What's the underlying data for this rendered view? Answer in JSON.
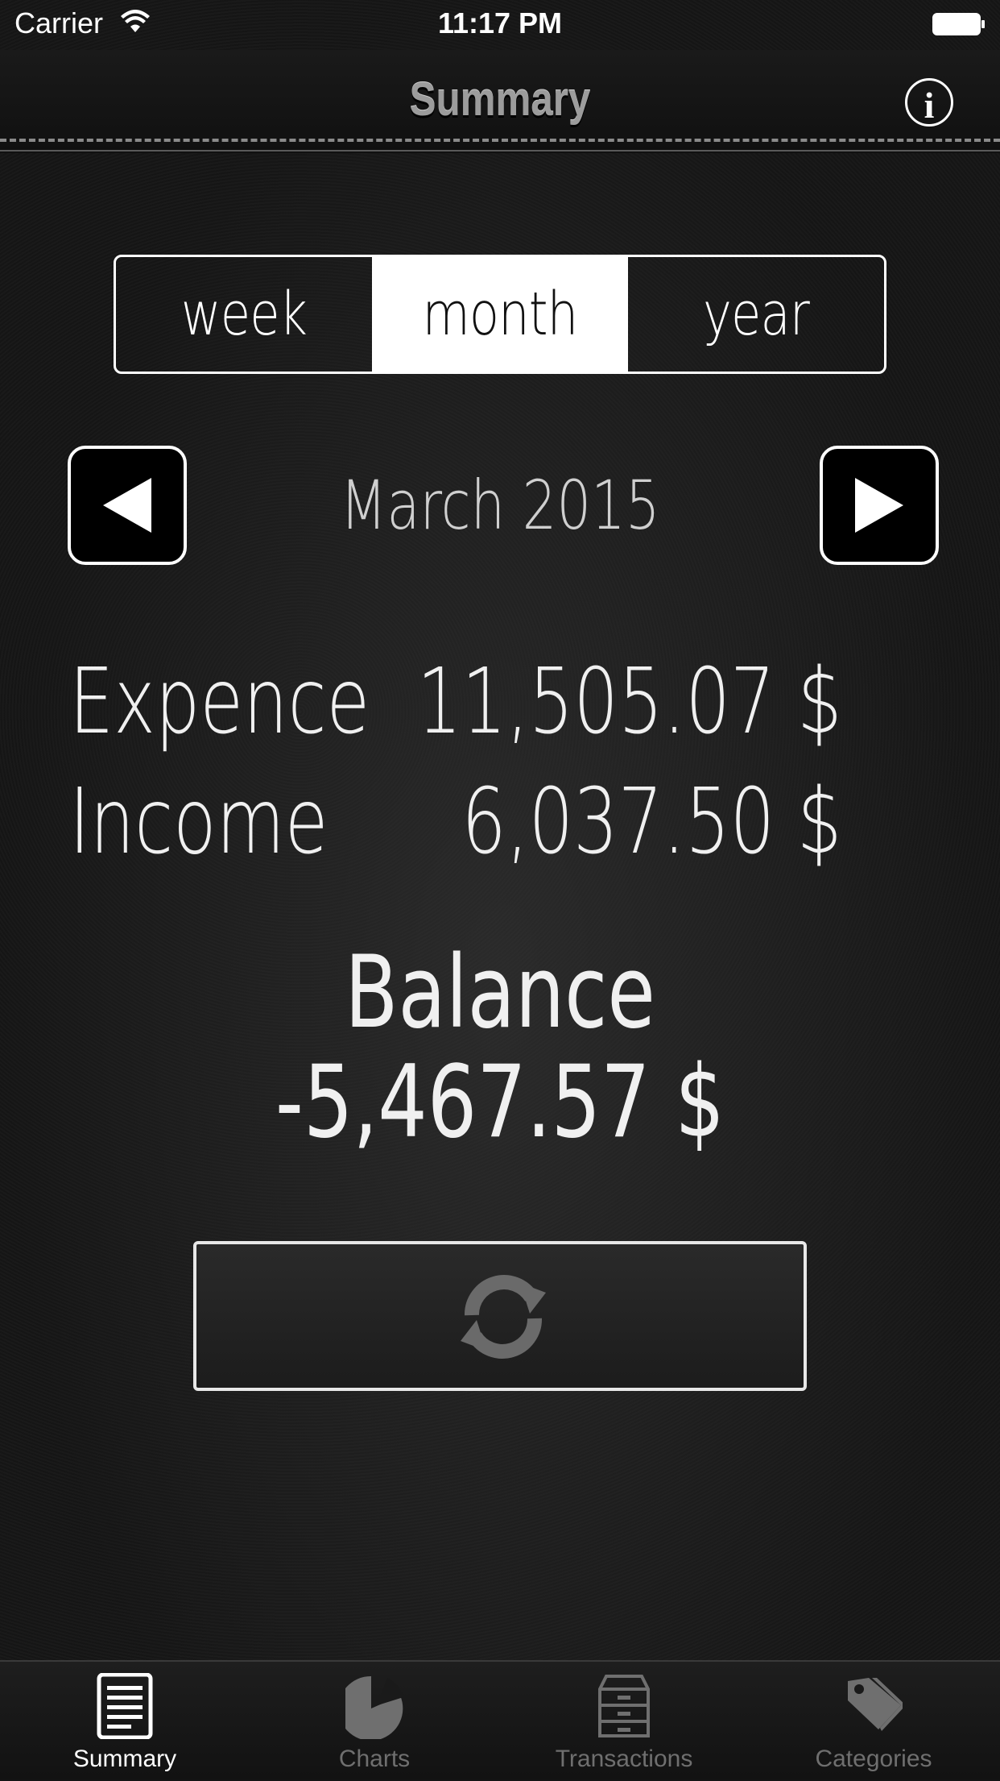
{
  "status_bar": {
    "carrier": "Carrier",
    "time": "11:17 PM"
  },
  "nav": {
    "title": "Summary",
    "info_label": "i"
  },
  "segments": [
    {
      "label": "week",
      "selected": false
    },
    {
      "label": "month",
      "selected": true
    },
    {
      "label": "year",
      "selected": false
    }
  ],
  "period": {
    "label": "March 2015"
  },
  "summary": {
    "expence_label": "Expence",
    "expence_value": "11,505.07 $",
    "income_label": "Income",
    "income_value": "6,037.50 $",
    "balance_label": "Balance",
    "balance_value": "-5,467.57 $"
  },
  "tabs": [
    {
      "label": "Summary",
      "icon": "summary-list-icon",
      "active": true
    },
    {
      "label": "Charts",
      "icon": "pie-chart-icon",
      "active": false
    },
    {
      "label": "Transactions",
      "icon": "cabinet-icon",
      "active": false
    },
    {
      "label": "Categories",
      "icon": "tags-icon",
      "active": false
    }
  ],
  "colors": {
    "background": "#161616",
    "text": "#f0f0f0",
    "inactive_tab": "#6f6f6f",
    "nav_title": "#9c9c9c"
  }
}
